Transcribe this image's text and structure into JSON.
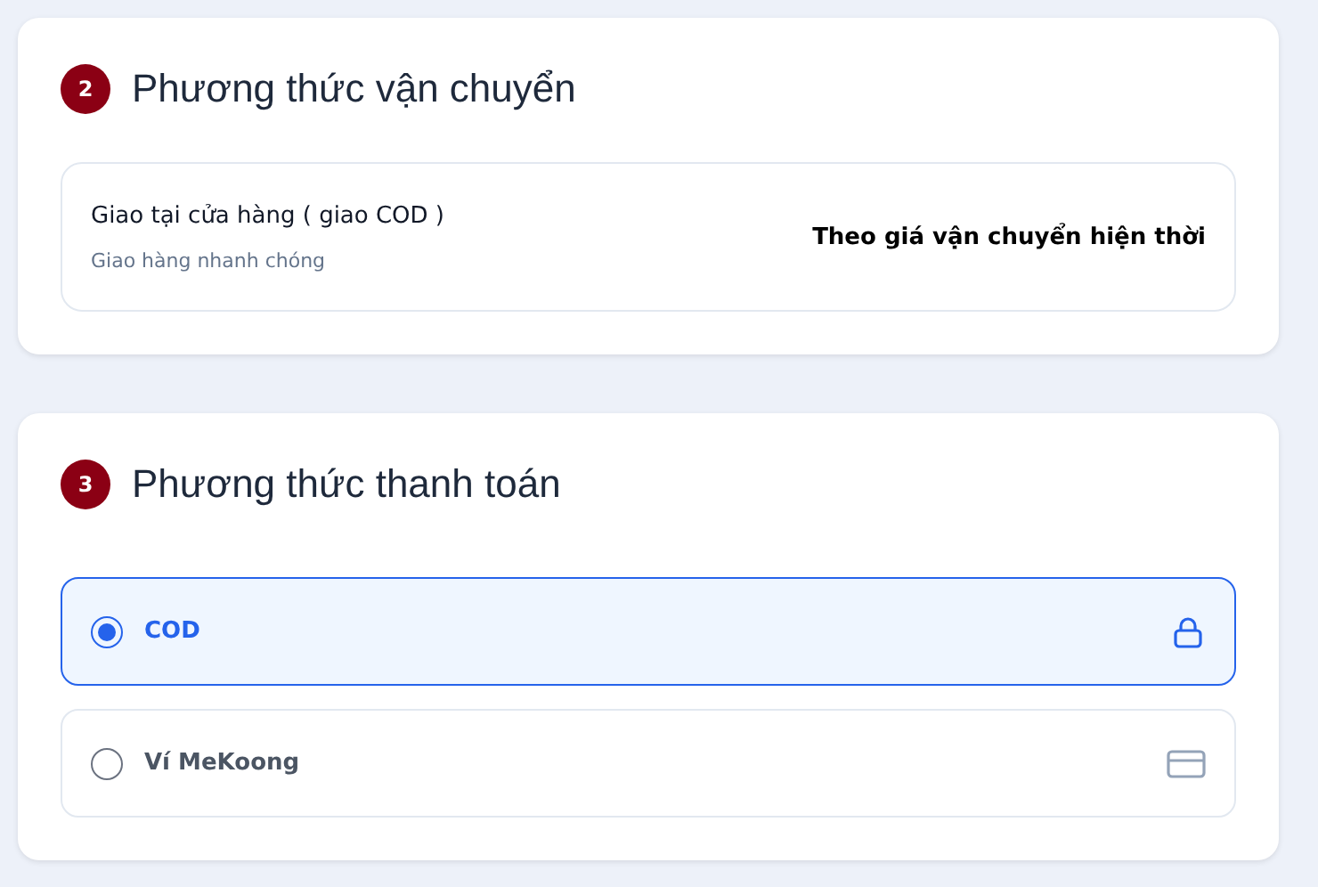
{
  "shipping": {
    "step": "2",
    "title": "Phương thức vận chuyển",
    "option": {
      "name": "Giao tại cửa hàng ( giao COD )",
      "description": "Giao hàng nhanh chóng",
      "price": "Theo giá vận chuyển hiện thời"
    }
  },
  "payment": {
    "step": "3",
    "title": "Phương thức thanh toán",
    "options": [
      {
        "label": "COD",
        "selected": true,
        "kind": "lock"
      },
      {
        "label": "Ví MeKoong",
        "selected": false,
        "kind": "card"
      }
    ]
  }
}
